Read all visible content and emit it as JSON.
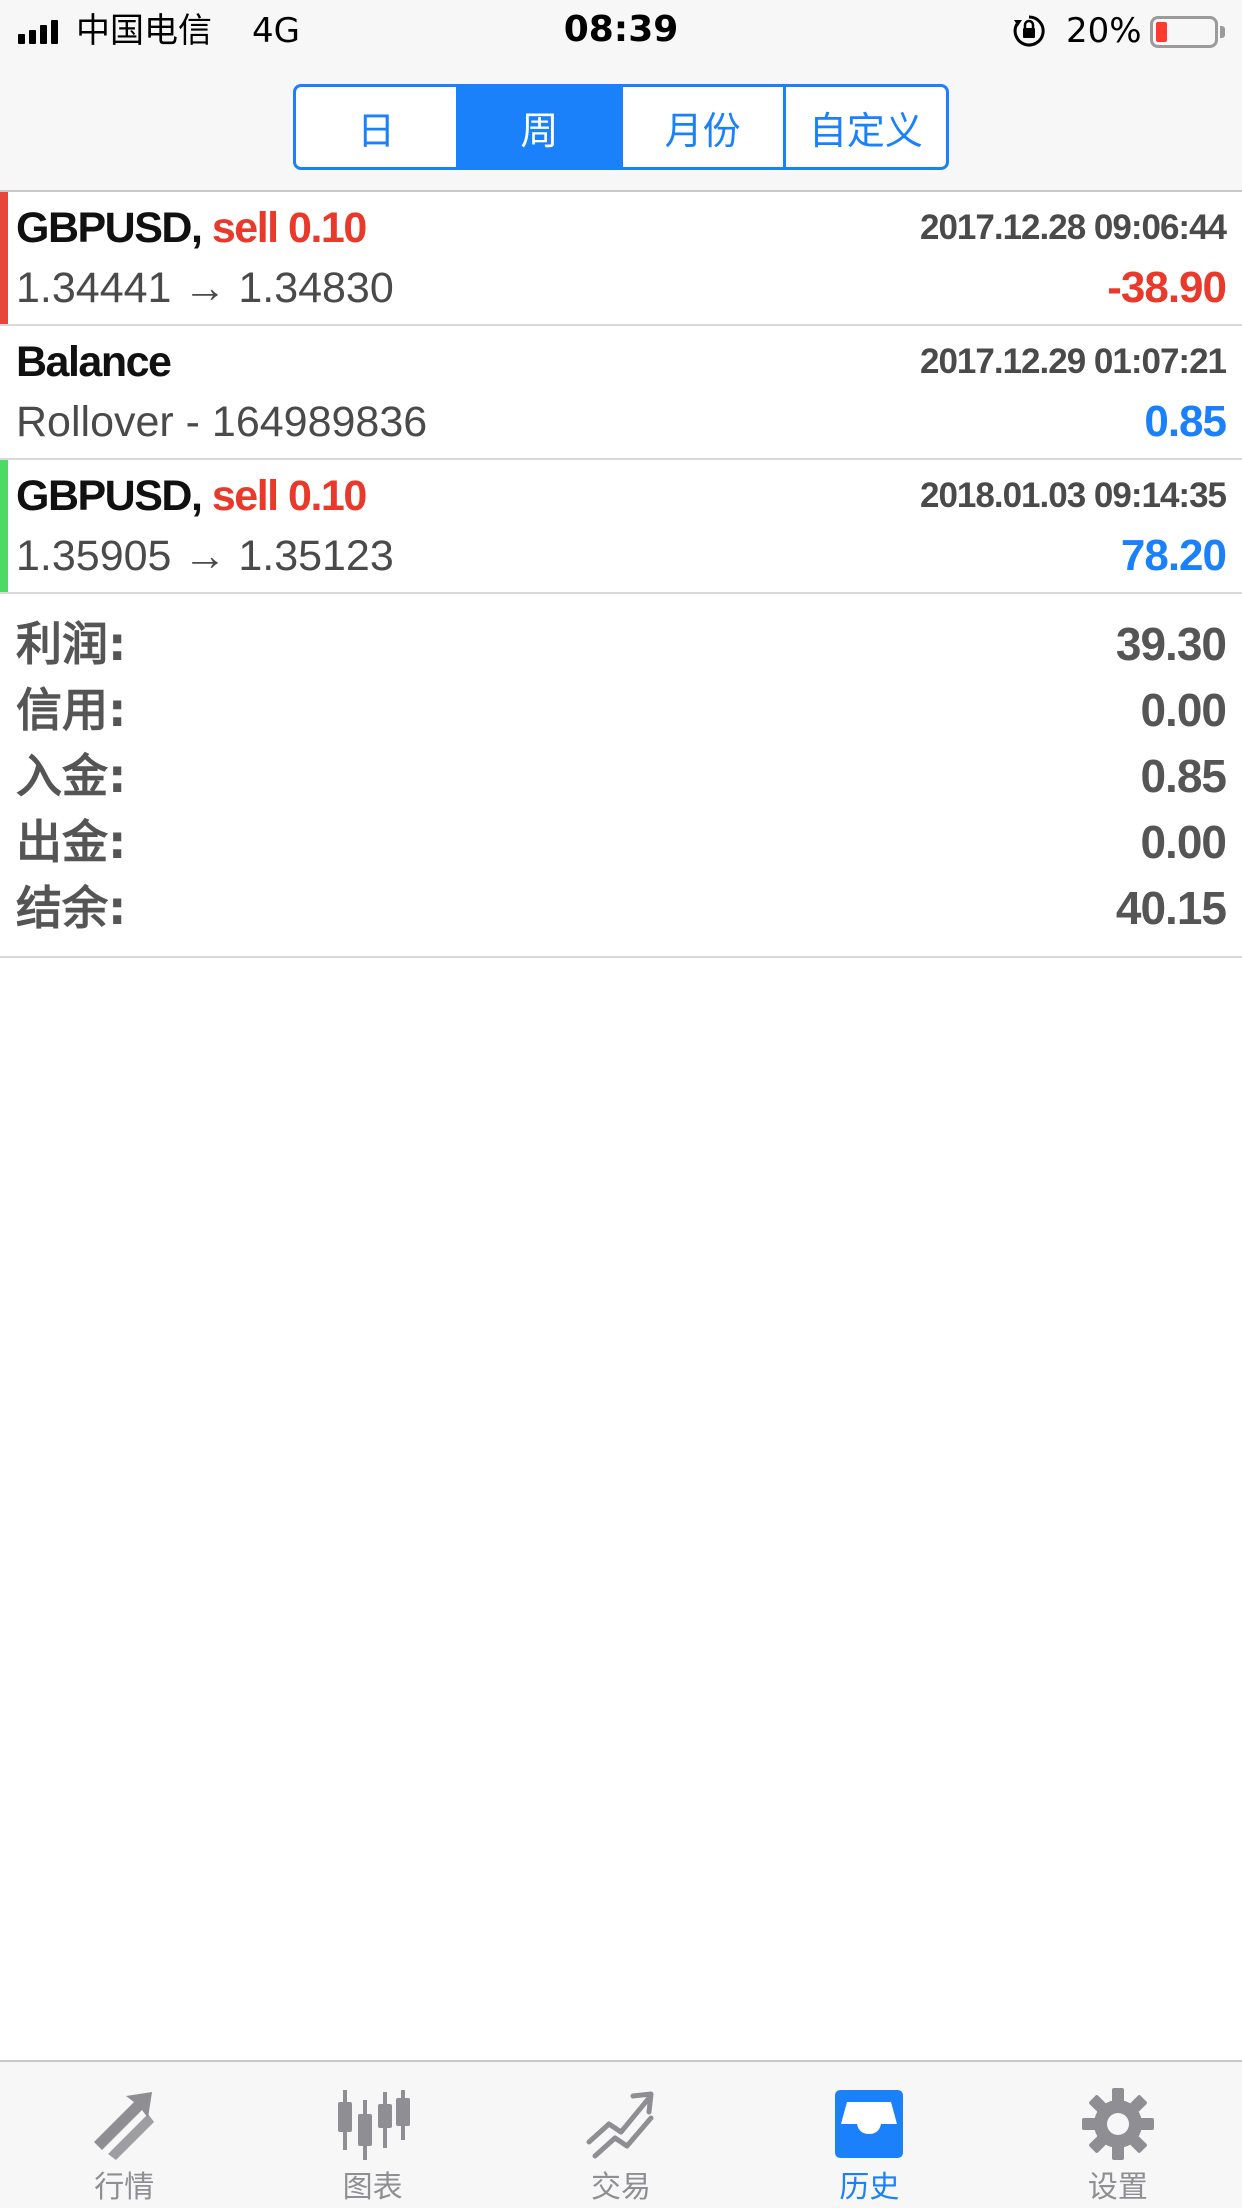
{
  "status_bar": {
    "carrier": "中国电信",
    "network": "4G",
    "time": "08:39",
    "battery": "20%"
  },
  "period_tabs": [
    {
      "label": "日",
      "active": false
    },
    {
      "label": "周",
      "active": true
    },
    {
      "label": "月份",
      "active": false
    },
    {
      "label": "自定义",
      "active": false
    }
  ],
  "deals": [
    {
      "symbol": "GBPUSD,",
      "type": "sell 0.10",
      "time": "2017.12.28 09:06:44",
      "prices": "1.34441 → 1.34830",
      "profit": "-38.90",
      "profit_color": "#e8392b",
      "bar_color": "#e8463a"
    },
    {
      "symbol": "Balance",
      "type": "",
      "time": "2017.12.29 01:07:21",
      "prices": "Rollover - 164989836",
      "profit": "0.85",
      "profit_color": "#1a81fb",
      "bar_color": "#ffffff"
    },
    {
      "symbol": "GBPUSD,",
      "type": "sell 0.10",
      "time": "2018.01.03 09:14:35",
      "prices": "1.35905 → 1.35123",
      "profit": "78.20",
      "profit_color": "#1a81fb",
      "bar_color": "#4cd964"
    }
  ],
  "summary": [
    {
      "label": "利润:",
      "value": "39.30"
    },
    {
      "label": "信用:",
      "value": "0.00"
    },
    {
      "label": "入金:",
      "value": "0.85"
    },
    {
      "label": "出金:",
      "value": "0.00"
    },
    {
      "label": "结余:",
      "value": "40.15"
    }
  ],
  "tab_bar": [
    {
      "label": "行情",
      "icon": "quotes-icon",
      "active": false
    },
    {
      "label": "图表",
      "icon": "chart-icon",
      "active": false
    },
    {
      "label": "交易",
      "icon": "trade-icon",
      "active": false
    },
    {
      "label": "历史",
      "icon": "history-icon",
      "active": true
    },
    {
      "label": "设置",
      "icon": "settings-icon",
      "active": false
    }
  ],
  "colors": {
    "accent": "#1a81fb",
    "sell": "#e8392b",
    "inactive_icon": "#8e8e93"
  }
}
